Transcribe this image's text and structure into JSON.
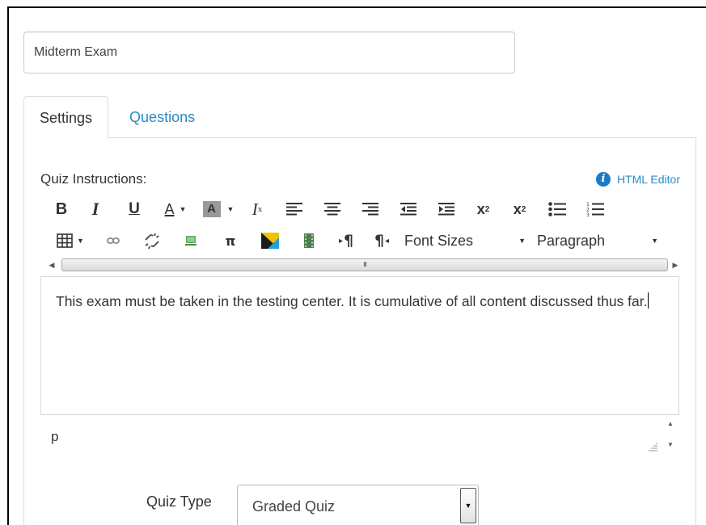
{
  "quiz_title": {
    "value": "Midterm Exam"
  },
  "tabs": [
    {
      "label": "Settings",
      "active": true
    },
    {
      "label": "Questions",
      "active": false
    }
  ],
  "instructions": {
    "label": "Quiz Instructions:",
    "html_editor_label": "HTML Editor",
    "content": "This exam must be taken in the testing center. It is cumulative of all content discussed thus far."
  },
  "toolbar": {
    "row1": [
      {
        "name": "bold",
        "glyph": "B"
      },
      {
        "name": "italic",
        "glyph": "I"
      },
      {
        "name": "underline",
        "glyph": "U"
      },
      {
        "name": "font-color",
        "glyph": "A"
      },
      {
        "name": "background-color",
        "glyph": "A"
      },
      {
        "name": "clear-formatting",
        "glyph": "I",
        "sub": "x"
      },
      {
        "name": "align-left"
      },
      {
        "name": "align-center"
      },
      {
        "name": "align-right"
      },
      {
        "name": "outdent"
      },
      {
        "name": "indent"
      },
      {
        "name": "superscript",
        "glyph": "x",
        "sup": "2"
      },
      {
        "name": "subscript",
        "glyph": "x",
        "sub": "2"
      },
      {
        "name": "bullet-list"
      },
      {
        "name": "numbered-list"
      }
    ],
    "row2": [
      {
        "name": "table"
      },
      {
        "name": "link"
      },
      {
        "name": "unlink"
      },
      {
        "name": "image"
      },
      {
        "name": "math",
        "glyph": "π"
      },
      {
        "name": "media"
      },
      {
        "name": "video"
      },
      {
        "name": "ltr",
        "glyph": "¶"
      },
      {
        "name": "rtl",
        "glyph": "¶"
      }
    ],
    "font_sizes_label": "Font Sizes",
    "paragraph_label": "Paragraph"
  },
  "status_bar": {
    "path": "p"
  },
  "quiz_type": {
    "label": "Quiz Type",
    "value": "Graded Quiz"
  },
  "colors": {
    "link": "#2a8ac6",
    "info_icon": "#1a7bc4",
    "border": "#dddddd"
  }
}
